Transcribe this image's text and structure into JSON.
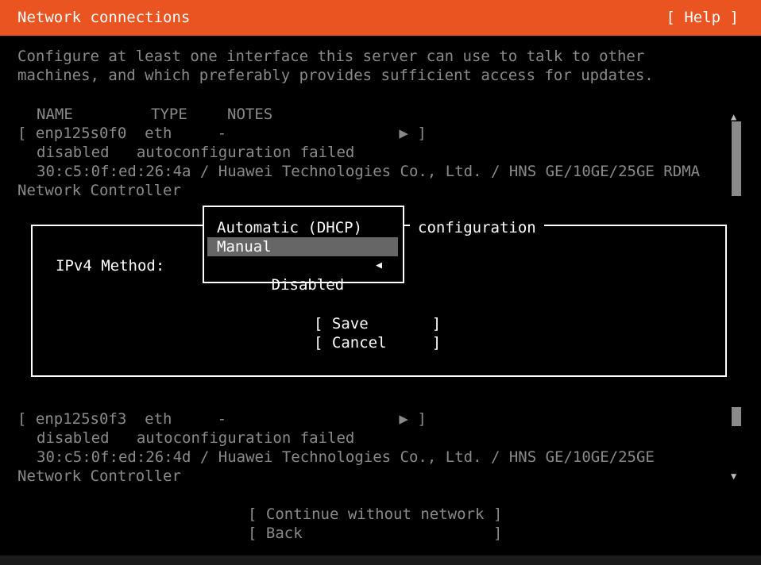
{
  "header": {
    "title": "Network connections",
    "help_label": "[ Help ]"
  },
  "intro": {
    "line1": "Configure at least one interface this server can use to talk to other",
    "line2": "machines, and which preferably provides sufficient access for updates."
  },
  "table": {
    "headers": {
      "name": "NAME",
      "type": "TYPE",
      "notes": "NOTES"
    },
    "interfaces": [
      {
        "row": "[ enp125s0f0  eth     -                   ▶ ]",
        "status": "disabled   autoconfiguration failed",
        "detail": "30:c5:0f:ed:26:4a / Huawei Technologies Co., Ltd. / HNS GE/10GE/25GE RDMA",
        "detail2": "Network Controller"
      },
      {
        "row": "[ enp125s0f3  eth     -                   ▶ ]",
        "status": "disabled   autoconfiguration failed",
        "detail": "30:c5:0f:ed:26:4d / Huawei Technologies Co., Ltd. / HNS GE/10GE/25GE",
        "detail2": "Network Controller"
      }
    ]
  },
  "dialog": {
    "title": "configuration",
    "ipv4_label": "IPv4 Method:",
    "options": [
      "Automatic (DHCP)",
      "Manual",
      "Disabled"
    ],
    "selected_option": "Manual",
    "marker": "◀",
    "save_label": "[ Save       ]",
    "cancel_label": "[ Cancel     ]"
  },
  "footer": {
    "continue_label": "[ Continue without network ]",
    "back_label": "[ Back                     ]"
  },
  "scroll": {
    "up": "▲",
    "down": "▼"
  },
  "colors": {
    "accent": "#e95420",
    "dim_text": "#8a8a8a",
    "selection": "#666666"
  }
}
